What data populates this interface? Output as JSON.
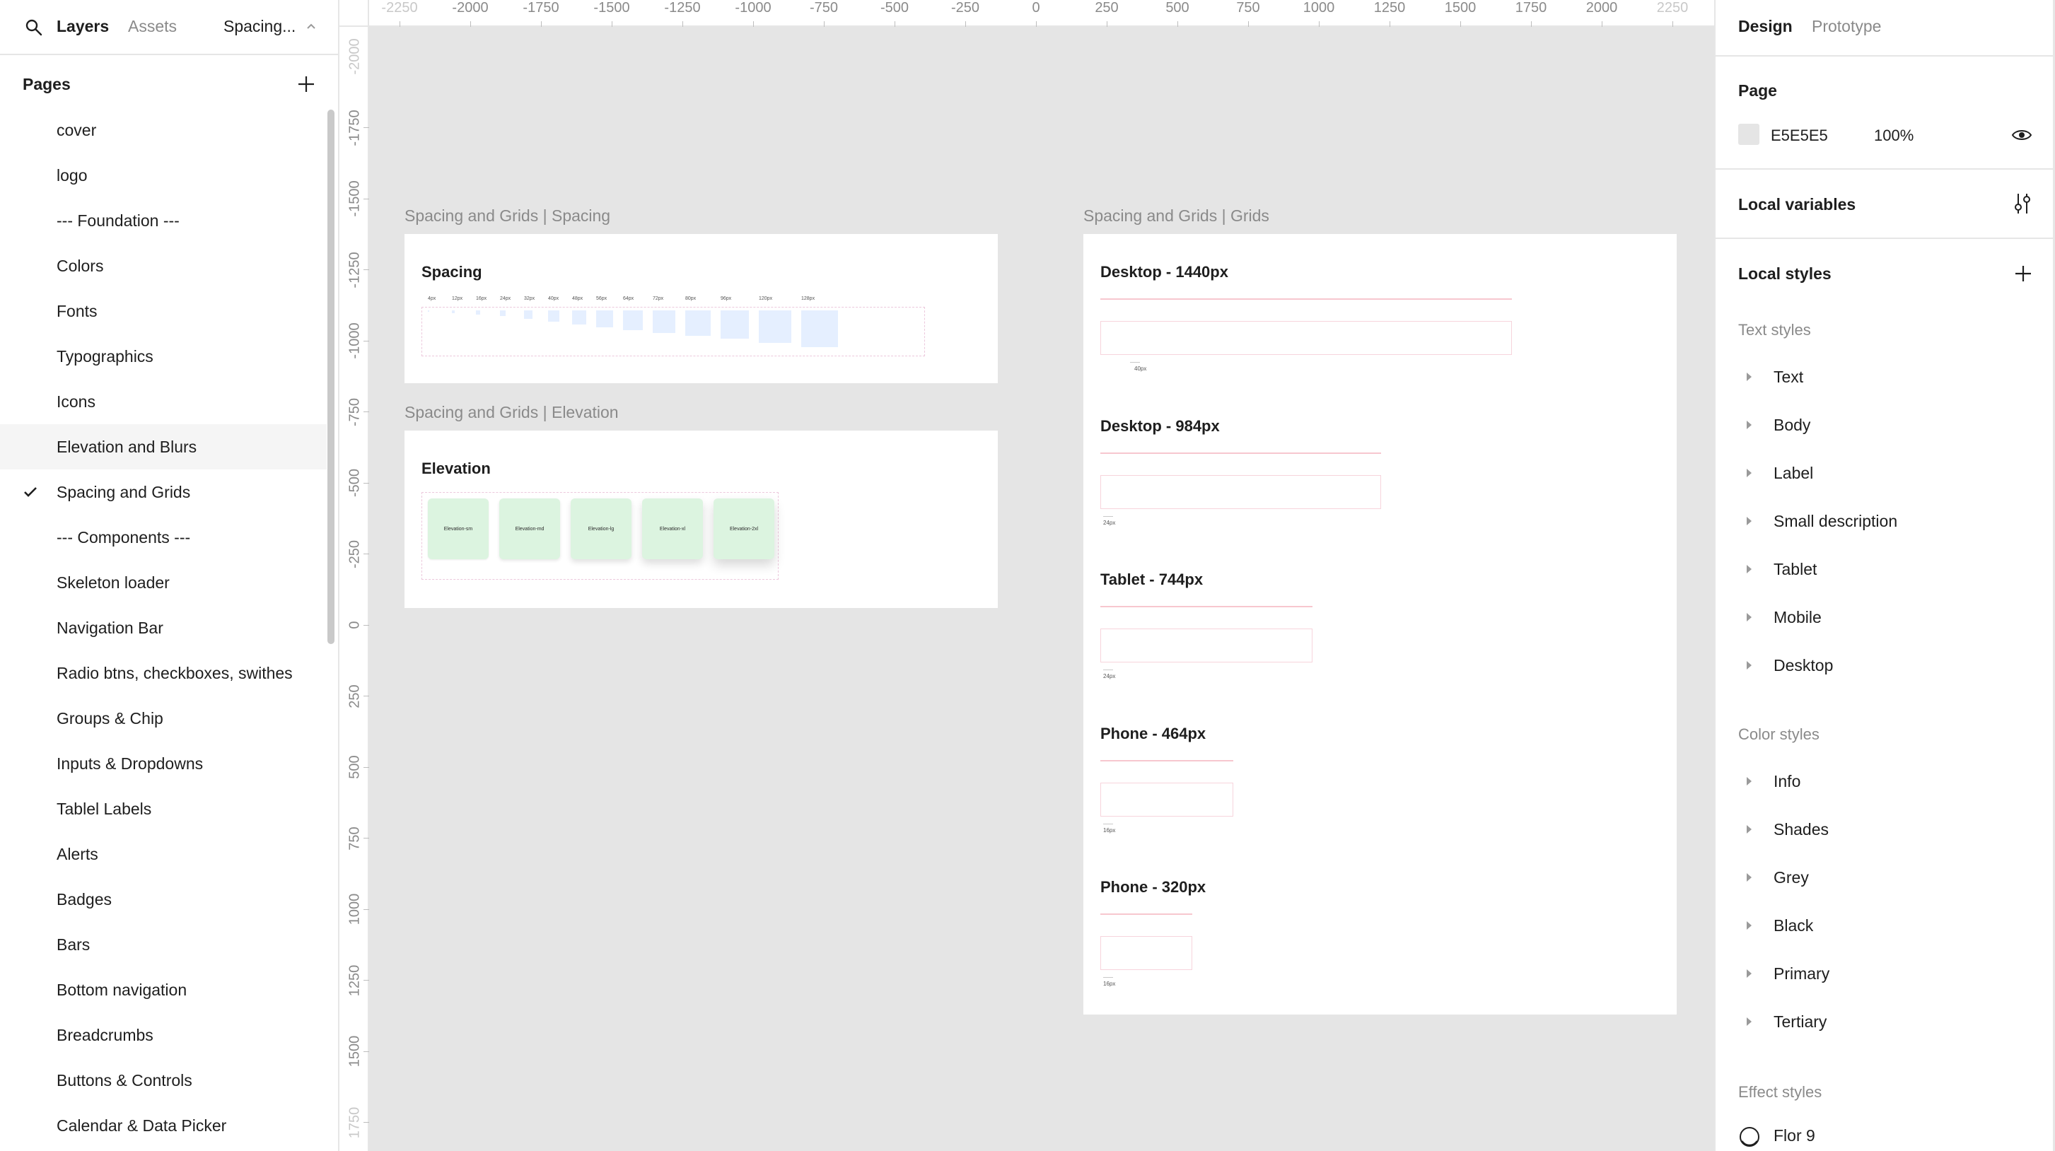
{
  "left_panel": {
    "tabs": {
      "layers": "Layers",
      "assets": "Assets"
    },
    "current_page": "Spacing...",
    "pages_title": "Pages",
    "pages": [
      {
        "label": "cover"
      },
      {
        "label": "logo"
      },
      {
        "label": "--- Foundation ---"
      },
      {
        "label": "Colors"
      },
      {
        "label": "Fonts"
      },
      {
        "label": "Typographics"
      },
      {
        "label": "Icons"
      },
      {
        "label": "Elevation and Blurs",
        "hovered": true
      },
      {
        "label": "Spacing and Grids",
        "selected": true
      },
      {
        "label": "--- Components ---"
      },
      {
        "label": "Skeleton loader"
      },
      {
        "label": "Navigation Bar"
      },
      {
        "label": "Radio btns, checkboxes, swithes"
      },
      {
        "label": "Groups & Chip"
      },
      {
        "label": "Inputs & Dropdowns"
      },
      {
        "label": "Tablel Labels"
      },
      {
        "label": "Alerts"
      },
      {
        "label": "Badges"
      },
      {
        "label": "Bars"
      },
      {
        "label": "Bottom navigation"
      },
      {
        "label": "Breadcrumbs"
      },
      {
        "label": "Buttons & Controls"
      },
      {
        "label": "Calendar & Data Picker"
      }
    ]
  },
  "rulers": {
    "top": [
      "-2250",
      "-2000",
      "-1750",
      "-1500",
      "-1250",
      "-1000",
      "-750",
      "-500",
      "-250",
      "0",
      "250",
      "500",
      "750",
      "1000",
      "1250",
      "1500",
      "1750",
      "2000",
      "2250"
    ],
    "left": [
      "-2000",
      "-1750",
      "-1500",
      "-1250",
      "-1000",
      "-750",
      "-500",
      "-250",
      "0",
      "250",
      "500",
      "750",
      "1000",
      "1250",
      "1500",
      "1750"
    ]
  },
  "canvas": {
    "spacing_frame": {
      "title": "Spacing and Grids | Spacing",
      "heading": "Spacing",
      "labels": [
        "4px",
        "12px",
        "16px",
        "24px",
        "32px",
        "40px",
        "48px",
        "56px",
        "64px",
        "72px",
        "80px",
        "96px",
        "120px",
        "128px"
      ]
    },
    "elevation_frame": {
      "title": "Spacing and Grids | Elevation",
      "heading": "Elevation",
      "cards": [
        "Elevation-sm",
        "Elevation-md",
        "Elevation-lg",
        "Elevation-xl",
        "Elevation-2xl"
      ]
    },
    "grids_frame": {
      "title": "Spacing and Grids | Grids",
      "sections": [
        {
          "heading": "Desktop - 1440px",
          "note": "40px"
        },
        {
          "heading": "Desktop - 984px",
          "note": "24px"
        },
        {
          "heading": "Tablet - 744px",
          "note": "24px"
        },
        {
          "heading": "Phone - 464px",
          "note": "16px"
        },
        {
          "heading": "Phone - 320px",
          "note": "16px"
        }
      ]
    }
  },
  "right_panel": {
    "tabs": {
      "design": "Design",
      "prototype": "Prototype"
    },
    "page": {
      "title": "Page",
      "color": "E5E5E5",
      "opacity": "100%"
    },
    "local_variables": "Local variables",
    "local_styles": "Local styles",
    "text_styles": {
      "title": "Text styles",
      "items": [
        "Text",
        "Body",
        "Label",
        "Small description",
        "Tablet",
        "Mobile",
        "Desktop"
      ]
    },
    "color_styles": {
      "title": "Color styles",
      "items": [
        "Info",
        "Shades",
        "Grey",
        "Black",
        "Primary",
        "Tertiary"
      ]
    },
    "effect_styles": {
      "title": "Effect styles",
      "items": [
        "Flor 9"
      ]
    }
  }
}
